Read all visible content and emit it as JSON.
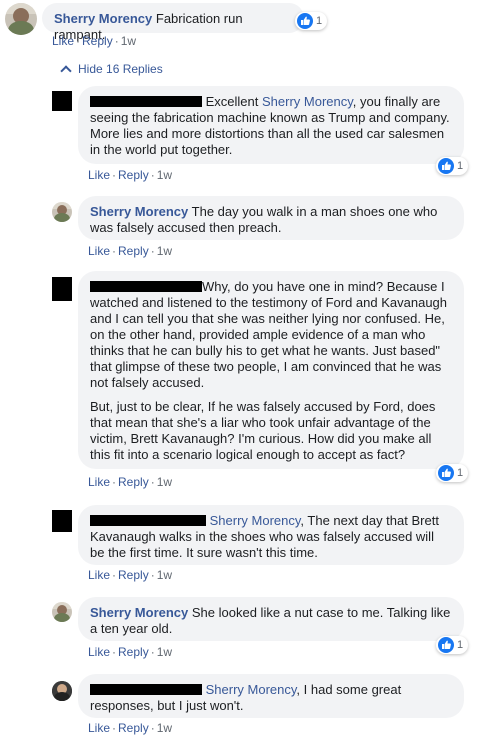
{
  "main_comment": {
    "author": "Sherry Morency",
    "text": "Fabrication run rampant.",
    "reaction_count": "1",
    "actions": {
      "like": "Like",
      "reply": "Reply",
      "time": "1w"
    }
  },
  "hide_replies_label": "Hide 16 Replies",
  "replies": [
    {
      "author": "",
      "mention": "Sherry Morency",
      "text_before": "Excellent ",
      "text_after": ", you finally are seeing the fabrication machine known as Trump and company. More lies and more distortions than all the used car salesmen in the world put together.",
      "reaction_count": "1",
      "actions": {
        "like": "Like",
        "reply": "Reply",
        "time": "1w"
      }
    },
    {
      "author": "Sherry Morency",
      "text": "The day you walk in a man shoes one who was falsely accused then preach.",
      "actions": {
        "like": "Like",
        "reply": "Reply",
        "time": "1w"
      }
    },
    {
      "author": "",
      "text": "Why, do you have one in mind? Because I watched and listened to the testimony of Ford and Kavanaugh and I can tell you that she was neither lying nor confused. He, on the other hand, provided ample evidence of a man who thinks that he can bully his to get what he wants. Just based\" that glimpse of these two people, I am convinced that he was not falsely accused.",
      "text2": "But, just to be clear, If he was falsely accused by Ford, does that mean that she's a liar who took unfair advantage of the victim, Brett Kavanaugh? I'm curious. How did you make all this fit into a scenario logical enough to accept as fact?",
      "reaction_count": "1",
      "actions": {
        "like": "Like",
        "reply": "Reply",
        "time": "1w"
      }
    },
    {
      "author": "",
      "mention": "Sherry Morency",
      "text_after": ", The next day that Brett Kavanaugh walks in the shoes who was falsely accused will be the first time. It sure wasn't this time.",
      "actions": {
        "like": "Like",
        "reply": "Reply",
        "time": "1w"
      }
    },
    {
      "author": "Sherry Morency",
      "text": "She looked like a nut case to me. Talking like a ten year old.",
      "reaction_count": "1",
      "actions": {
        "like": "Like",
        "reply": "Reply",
        "time": "1w"
      }
    },
    {
      "author": "",
      "mention": "Sherry Morency",
      "text_after": ", I had some great responses, but I just won't.",
      "actions": {
        "like": "Like",
        "reply": "Reply",
        "time": "1w"
      }
    }
  ],
  "colors": {
    "link": "#385898",
    "bubble": "#f2f3f5",
    "like_blue": "#1877f2"
  }
}
